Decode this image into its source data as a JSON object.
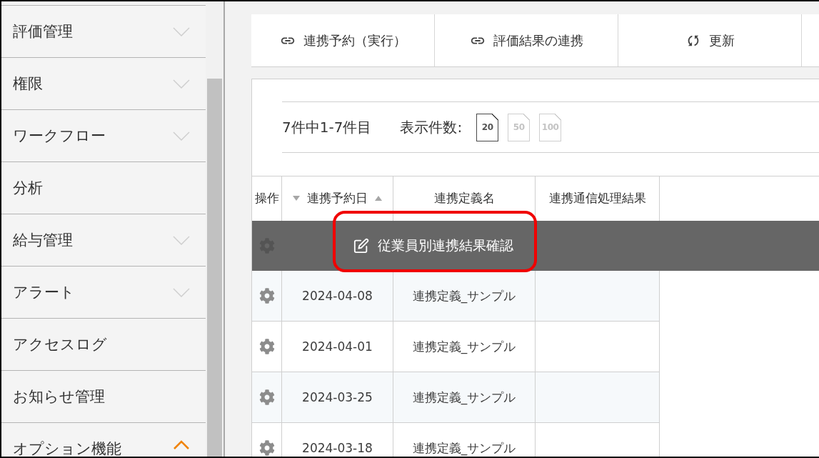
{
  "sidebar": {
    "items": [
      {
        "label": "評価管理",
        "kind": "group",
        "expanded": false
      },
      {
        "label": "権限",
        "kind": "group",
        "expanded": false
      },
      {
        "label": "ワークフロー",
        "kind": "group",
        "expanded": false
      },
      {
        "label": "分析",
        "kind": "link"
      },
      {
        "label": "給与管理",
        "kind": "group",
        "expanded": false
      },
      {
        "label": "アラート",
        "kind": "group",
        "expanded": false
      },
      {
        "label": "アクセスログ",
        "kind": "link"
      },
      {
        "label": "お知らせ管理",
        "kind": "link"
      },
      {
        "label": "オプション機能",
        "kind": "group",
        "expanded": true
      }
    ]
  },
  "toolbar": {
    "buttons": [
      {
        "label": "連携予約（実行）",
        "kind": "link"
      },
      {
        "label": "評価結果の連携",
        "kind": "link"
      },
      {
        "label": "更新",
        "kind": "refresh"
      }
    ]
  },
  "pager": {
    "summary": "7件中1-7件目",
    "page_size_label": "表示件数:",
    "page_sizes": [
      {
        "label": "20",
        "selected": true
      },
      {
        "label": "50",
        "selected": false
      },
      {
        "label": "100",
        "selected": false
      }
    ]
  },
  "table": {
    "columns": [
      {
        "label": "操作",
        "sortable": false
      },
      {
        "label": "連携予約日",
        "sortable": true
      },
      {
        "label": "連携定義名",
        "sortable": false
      },
      {
        "label": "連携通信処理結果",
        "sortable": false
      }
    ],
    "row_menu": {
      "items": [
        {
          "label": "従業員別連携結果確認"
        }
      ]
    },
    "rows": [
      {
        "date": "2024-04-08",
        "definition": "連携定義_サンプル"
      },
      {
        "date": "2024-04-01",
        "definition": "連携定義_サンプル"
      },
      {
        "date": "2024-03-25",
        "definition": "連携定義_サンプル"
      },
      {
        "date": "2024-03-18",
        "definition": "連携定義_サンプル"
      }
    ]
  }
}
